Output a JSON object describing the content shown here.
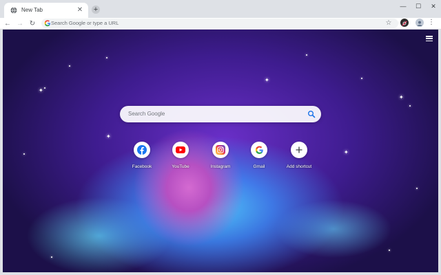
{
  "tab": {
    "title": "New Tab",
    "close_glyph": "✕"
  },
  "toolbar": {
    "omnibox_placeholder": "Search Google or type a URL",
    "back_glyph": "←",
    "forward_glyph": "→",
    "reload_glyph": "↻",
    "star_glyph": "☆",
    "menu_glyph": "⋮"
  },
  "window_controls": {
    "minimize": "—",
    "maximize": "☐",
    "close": "✕"
  },
  "ntp": {
    "search_placeholder": "Search Google",
    "shortcuts": [
      {
        "label": "Facebook",
        "icon": "facebook-icon",
        "color": "#1877f2"
      },
      {
        "label": "YouTube",
        "icon": "youtube-icon",
        "color": "#ff0000"
      },
      {
        "label": "Instagram",
        "icon": "instagram-icon",
        "color": "#c13584"
      },
      {
        "label": "Gmail",
        "icon": "google-icon",
        "color": "#4285f4"
      },
      {
        "label": "Add shortcut",
        "icon": "plus-icon",
        "color": "#3c4043"
      }
    ]
  },
  "colors": {
    "accent": "#1a73e8",
    "frame": "#dee1e6"
  }
}
